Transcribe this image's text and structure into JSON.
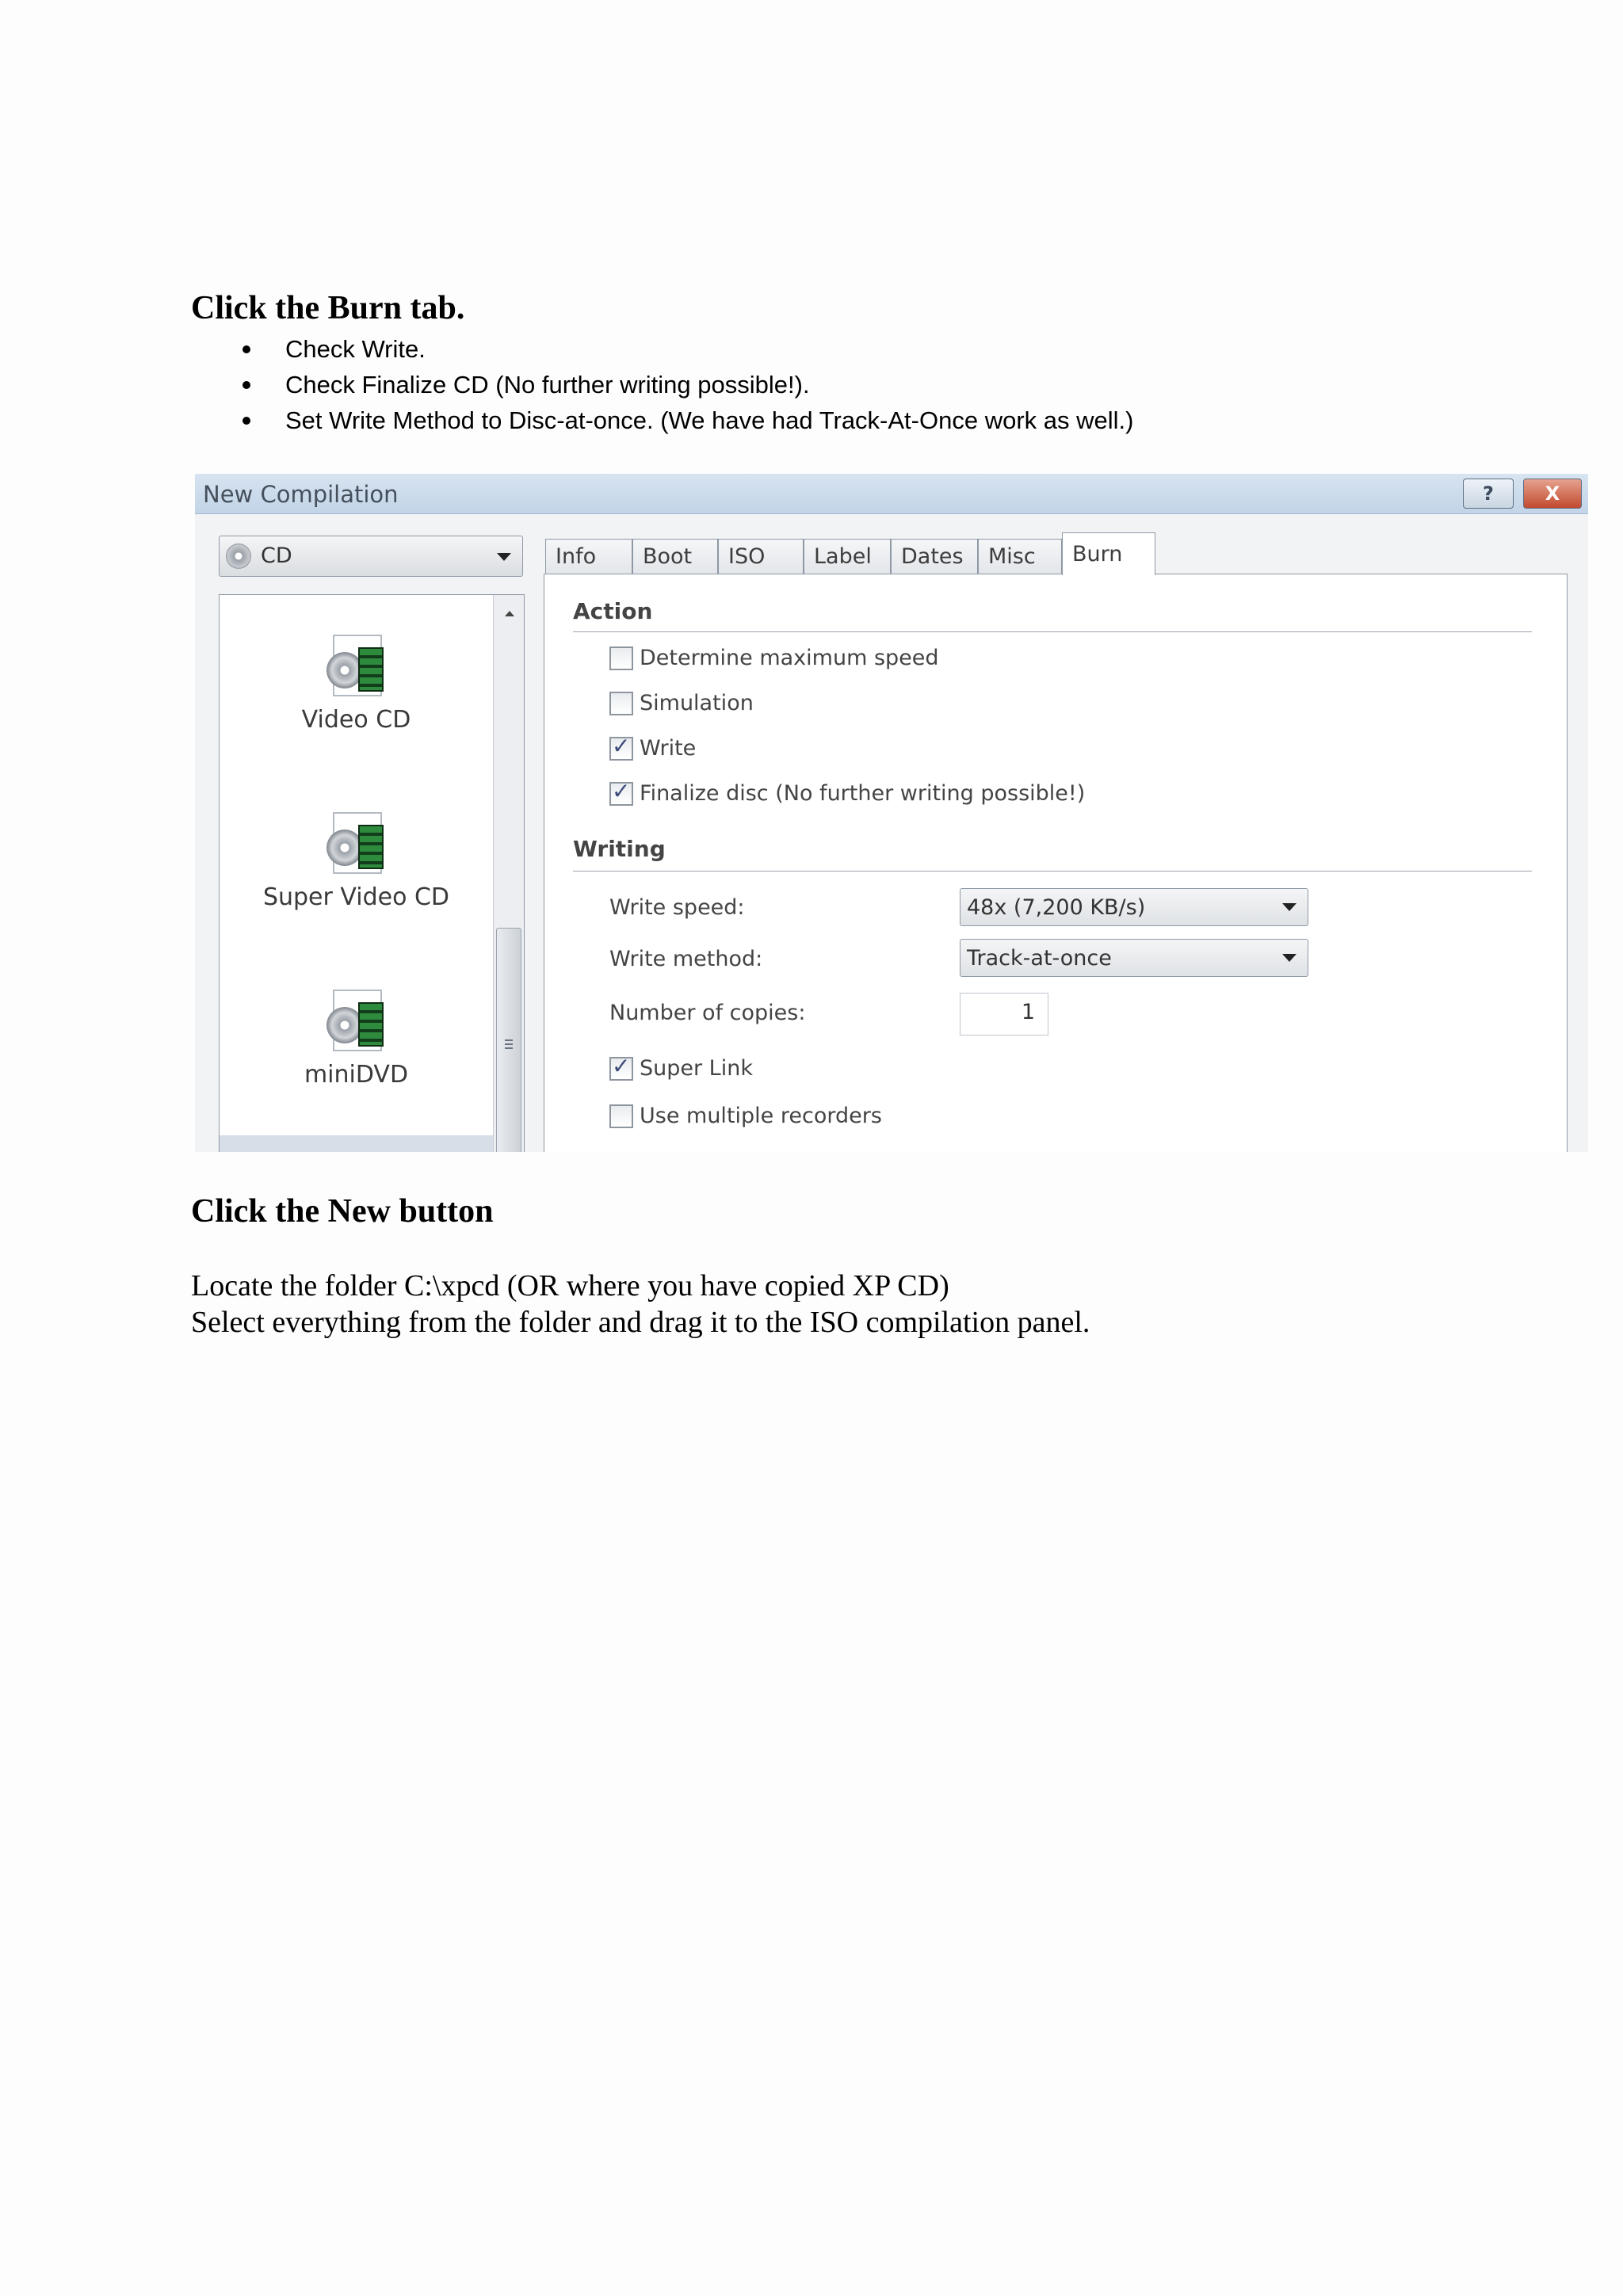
{
  "instructions": {
    "heading_1": "Click the Burn tab.",
    "bullets": [
      "Check Write.",
      "Check Finalize CD (No further writing possible!).",
      "Set Write Method to Disc-at-once. (We have had Track-At-Once work as well.)"
    ],
    "heading_2": "Click the New button",
    "paragraph_lines": [
      "Locate the folder C:\\xpcd (OR where you have copied XP CD)",
      "Select everything from the folder and drag it to the ISO compilation panel."
    ]
  },
  "dialog": {
    "title": "New Compilation",
    "help_button": "?",
    "close_button": "X",
    "media_select": "CD",
    "compilation_types": [
      {
        "label": "Video CD",
        "icon": "video-cd-icon"
      },
      {
        "label": "Super Video CD",
        "icon": "super-video-cd-icon"
      },
      {
        "label": "miniDVD",
        "icon": "minidvd-icon"
      }
    ],
    "tabs": [
      "Info",
      "Boot",
      "ISO",
      "Label",
      "Dates",
      "Misc",
      "Burn"
    ],
    "active_tab": "Burn",
    "action": {
      "title": "Action",
      "options": [
        {
          "label": "Determine maximum speed",
          "checked": false
        },
        {
          "label": "Simulation",
          "checked": false
        },
        {
          "label": "Write",
          "checked": true
        },
        {
          "label": "Finalize disc (No further writing possible!)",
          "checked": true
        }
      ]
    },
    "writing": {
      "title": "Writing",
      "write_speed_label": "Write speed:",
      "write_speed_value": "48x (7,200 KB/s)",
      "write_method_label": "Write method:",
      "write_method_value": "Track-at-once",
      "copies_label": "Number of copies:",
      "copies_value": "1",
      "options": [
        {
          "label": "Super Link",
          "checked": true
        },
        {
          "label": "Use multiple recorders",
          "checked": false
        }
      ]
    }
  }
}
